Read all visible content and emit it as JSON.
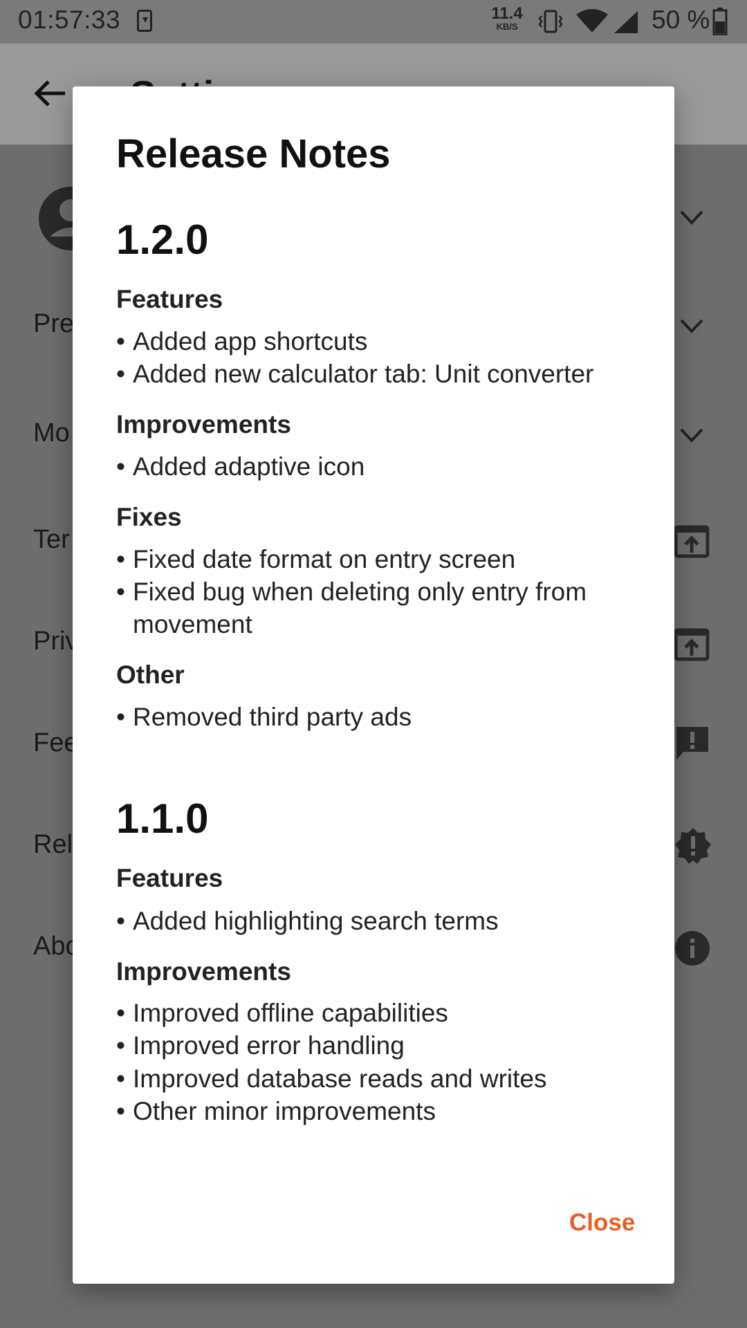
{
  "status_bar": {
    "time": "01:57:33",
    "net_speed_value": "11.4",
    "net_speed_unit": "KB/S",
    "battery": "50 %"
  },
  "background_page": {
    "title": "Setti",
    "items": [
      {
        "label": "Pre"
      },
      {
        "label": "Mo"
      },
      {
        "label": "Ter"
      },
      {
        "label": "Priv"
      },
      {
        "label": "Fee"
      },
      {
        "label": "Rel"
      },
      {
        "label": "Abo"
      }
    ]
  },
  "dialog": {
    "title": "Release Notes",
    "versions": [
      {
        "version": "1.2.0",
        "sections": [
          {
            "heading": "Features",
            "items": [
              "Added app shortcuts",
              "Added new calculator tab: Unit converter"
            ]
          },
          {
            "heading": "Improvements",
            "items": [
              "Added adaptive icon"
            ]
          },
          {
            "heading": "Fixes",
            "items": [
              "Fixed date format on entry screen",
              "Fixed bug when deleting only entry from",
              "movement"
            ]
          },
          {
            "heading": "Other",
            "items": [
              "Removed third party ads"
            ]
          }
        ]
      },
      {
        "version": "1.1.0",
        "sections": [
          {
            "heading": "Features",
            "items": [
              "Added highlighting search terms"
            ]
          },
          {
            "heading": "Improvements",
            "items": [
              "Improved offline capabilities",
              "Improved error handling",
              "Improved database reads and writes",
              "Other minor improvements"
            ]
          }
        ]
      }
    ],
    "close_label": "Close"
  },
  "colors": {
    "accent": "#ea5d25",
    "scrim": "#6e6e6e",
    "dialog_bg": "#ffffff"
  }
}
